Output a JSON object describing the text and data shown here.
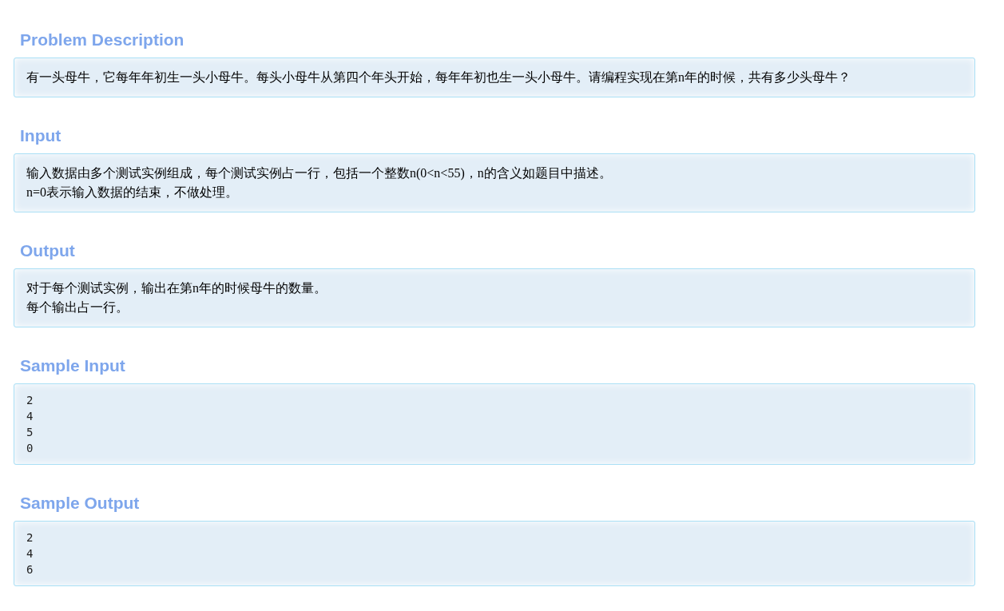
{
  "sections": [
    {
      "title": "Problem Description",
      "kind": "text",
      "lines": [
        "有一头母牛，它每年年初生一头小母牛。每头小母牛从第四个年头开始，每年年初也生一头小母牛。请编程实现在第n年的时候，共有多少头母牛？"
      ]
    },
    {
      "title": "Input",
      "kind": "text",
      "lines": [
        "输入数据由多个测试实例组成，每个测试实例占一行，包括一个整数n(0<n<55)，n的含义如题目中描述。",
        "n=0表示输入数据的结束，不做处理。"
      ]
    },
    {
      "title": "Output",
      "kind": "text",
      "lines": [
        "对于每个测试实例，输出在第n年的时候母牛的数量。",
        "每个输出占一行。"
      ]
    },
    {
      "title": "Sample Input",
      "kind": "code",
      "lines": [
        "2",
        "4",
        "5",
        "0"
      ]
    },
    {
      "title": "Sample Output",
      "kind": "code",
      "lines": [
        "2",
        "4",
        "6"
      ]
    }
  ]
}
